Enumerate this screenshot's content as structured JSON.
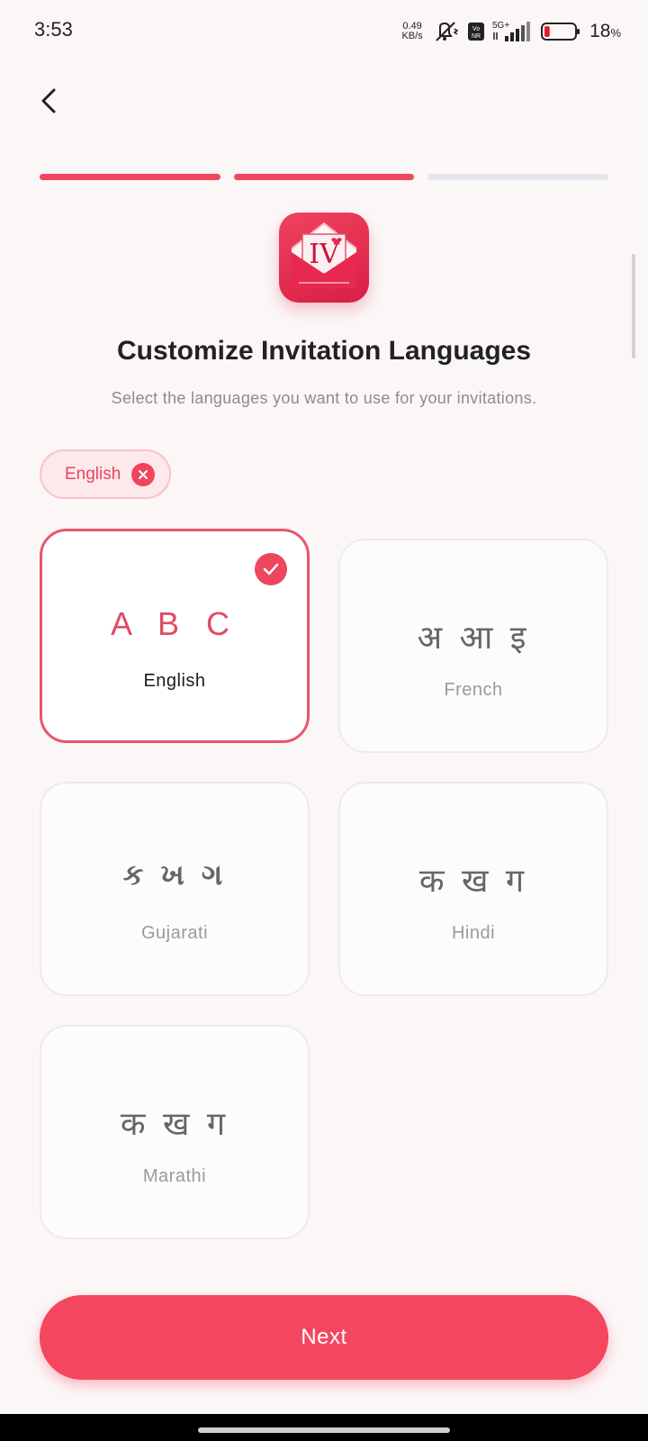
{
  "status_bar": {
    "time": "3:53",
    "net_speed_value": "0.49",
    "net_speed_unit": "KB/s",
    "network": "5G+",
    "battery_percent": "18",
    "battery_unit": "%",
    "battery_level": 0.18,
    "icons": [
      "mute-vibrate-icon",
      "vonr-icon",
      "signal-icon",
      "battery-icon"
    ]
  },
  "header": {
    "back_icon": "chevron-left-icon"
  },
  "progress": {
    "total_steps": 3,
    "completed_steps": 2,
    "active_color": "#f0475f",
    "inactive_color": "#e3e6ea"
  },
  "logo": {
    "text": "IV"
  },
  "title": "Customize Invitation Languages",
  "subtitle": "Select the languages you want to use for your invitations.",
  "selected_chips": [
    {
      "label": "English"
    }
  ],
  "languages": [
    {
      "glyphs": "A B C",
      "name": "English",
      "selected": true
    },
    {
      "glyphs": "अ आ इ",
      "name": "French",
      "selected": false
    },
    {
      "glyphs": "ક ખ ગ",
      "name": "Gujarati",
      "selected": false
    },
    {
      "glyphs": "क ख ग",
      "name": "Hindi",
      "selected": false
    },
    {
      "glyphs": "क ख ग",
      "name": "Marathi",
      "selected": false
    }
  ],
  "next_button": {
    "label": "Next"
  },
  "colors": {
    "accent": "#f5465f",
    "background": "#fbf7f7"
  }
}
